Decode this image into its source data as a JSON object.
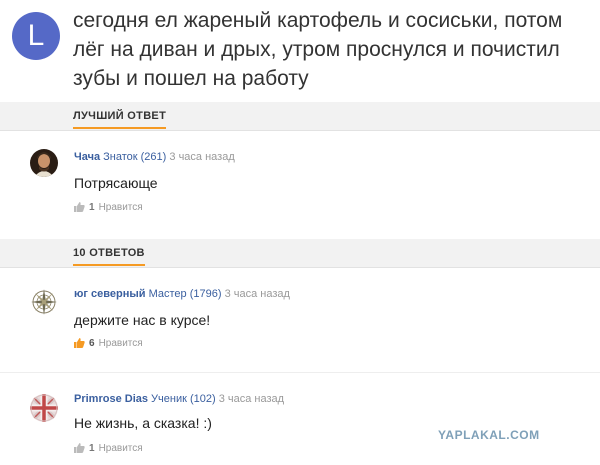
{
  "question": {
    "avatar_letter": "L",
    "text": "сегодня ел жареный картофель и сосиськи, потом лёг на диван и дрых, утром проснулся и почистил зубы и пошел на работу"
  },
  "best_answer_section": {
    "title": "ЛУЧШИЙ ОТВЕТ"
  },
  "answers_section": {
    "title": "10 ОТВЕТОВ"
  },
  "best_answer": {
    "avatar_icon": "portrait-avatar-icon",
    "name": "Чача",
    "rank": "Знаток (261)",
    "time": "3 часа назад",
    "text": "Потрясающе",
    "likes": "1",
    "like_label": "Нравится"
  },
  "answers": [
    {
      "avatar_icon": "compass-rose-avatar-icon",
      "name": "юг северный",
      "rank": "Мастер (1796)",
      "time": "3 часа назад",
      "text": "держите нас в курсе!",
      "likes": "6",
      "like_label": "Нравится"
    },
    {
      "avatar_icon": "union-jack-avatar-icon",
      "name": "Primrose Dias",
      "rank": "Ученик (102)",
      "time": "3 часа назад",
      "text": "Не жизнь, а сказка! :)",
      "likes": "1",
      "like_label": "Нравится"
    }
  ],
  "watermark": "YAPLAKAL.COM",
  "colors": {
    "accent": "#f59a23",
    "link": "#3a5f9f",
    "avatar_bg": "#5569c7"
  }
}
